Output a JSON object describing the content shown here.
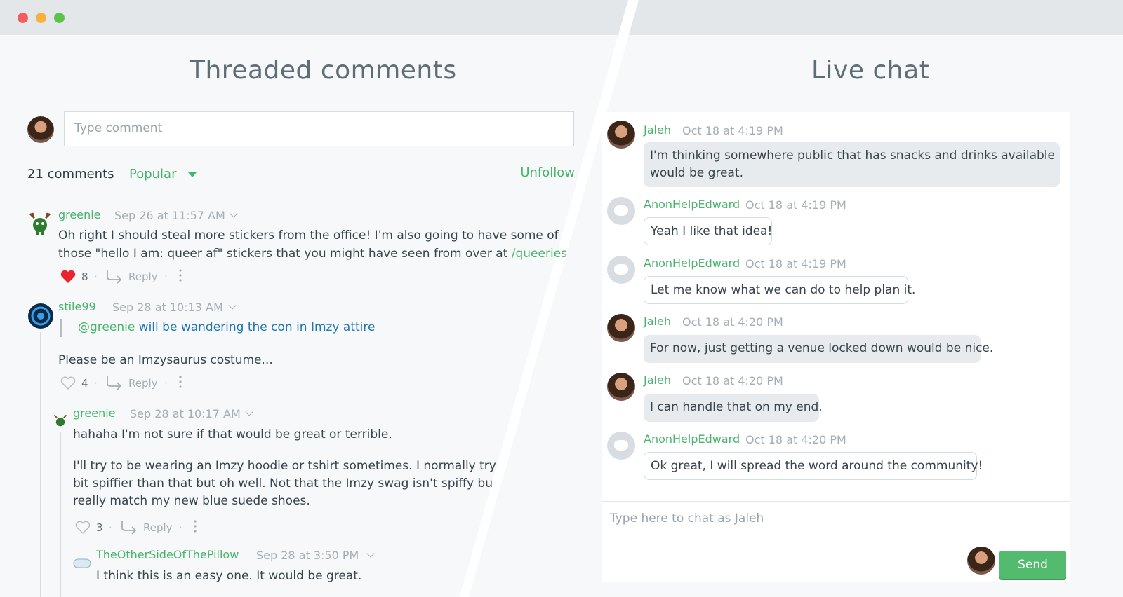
{
  "window": {
    "controls": [
      "close",
      "minimize",
      "maximize"
    ]
  },
  "left": {
    "title": "Threaded comments",
    "input_placeholder": "Type comment",
    "comment_count": "21 comments",
    "sort_label": "Popular",
    "unfollow_label": "Unfollow",
    "comments": [
      {
        "user": "greenie",
        "time": "Sep 26 at 11:57 AM",
        "line1": "Oh right I should steal more stickers from the office! I'm also going to have some of",
        "line2": "those \"hello I am: queer af\" stickers that you might have seen from over at ",
        "link": "/queeries",
        "likes": "8",
        "reply": "Reply",
        "liked": true
      },
      {
        "user": "stile99",
        "time": "Sep 28 at 10:13 AM",
        "quote_mention": "@greenie",
        "quote_text": " will be wandering the con in Imzy attire",
        "text": "Please be an Imzysaurus costume...",
        "likes": "4",
        "reply": "Reply",
        "liked": false
      },
      {
        "user": "greenie",
        "time": "Sep 28 at 10:17 AM",
        "line1": "hahaha I'm not sure if that would be great or terrible.",
        "line2": "I'll try to be wearing an Imzy hoodie or tshirt sometimes. I normally try",
        "line3": "bit spiffier than that but oh well. Not that the Imzy swag isn't spiffy bu",
        "line4": "really match my new blue suede shoes.",
        "likes": "3",
        "reply": "Reply",
        "liked": false
      },
      {
        "user": "TheOtherSideOfThePillow",
        "time": "Sep 28 at 3:50 PM",
        "text": "I think this is an easy one. It would be great."
      }
    ]
  },
  "right": {
    "title": "Live chat",
    "messages": [
      {
        "user": "Jaleh",
        "time": "Oct 18 at 4:19 PM",
        "line1": "I'm thinking somewhere public that has snacks and drinks available",
        "line2": "would be great.",
        "own": true
      },
      {
        "user": "AnonHelpEdward",
        "time": "Oct 18 at 4:19 PM",
        "text": "Yeah I like that idea!",
        "own": false
      },
      {
        "user": "AnonHelpEdward",
        "time": "Oct 18 at 4:19 PM",
        "text": "Let me know what we can do to help plan it.",
        "own": false
      },
      {
        "user": "Jaleh",
        "time": "Oct 18 at 4:20 PM",
        "text": "For now, just getting a venue locked down would be nice.",
        "own": true
      },
      {
        "user": "Jaleh",
        "time": "Oct 18 at 4:20 PM",
        "text": "I can handle that on my end.",
        "own": true
      },
      {
        "user": "AnonHelpEdward",
        "time": "Oct 18 at 4:20 PM",
        "text": "Ok great, I will spread the word around the community!",
        "own": false
      }
    ],
    "input_placeholder": "Type here to chat as Jaleh",
    "send_label": "Send"
  },
  "colors": {
    "accent": "#46b46a",
    "link_blue": "#1f74b6",
    "heart": "#e8242f"
  }
}
